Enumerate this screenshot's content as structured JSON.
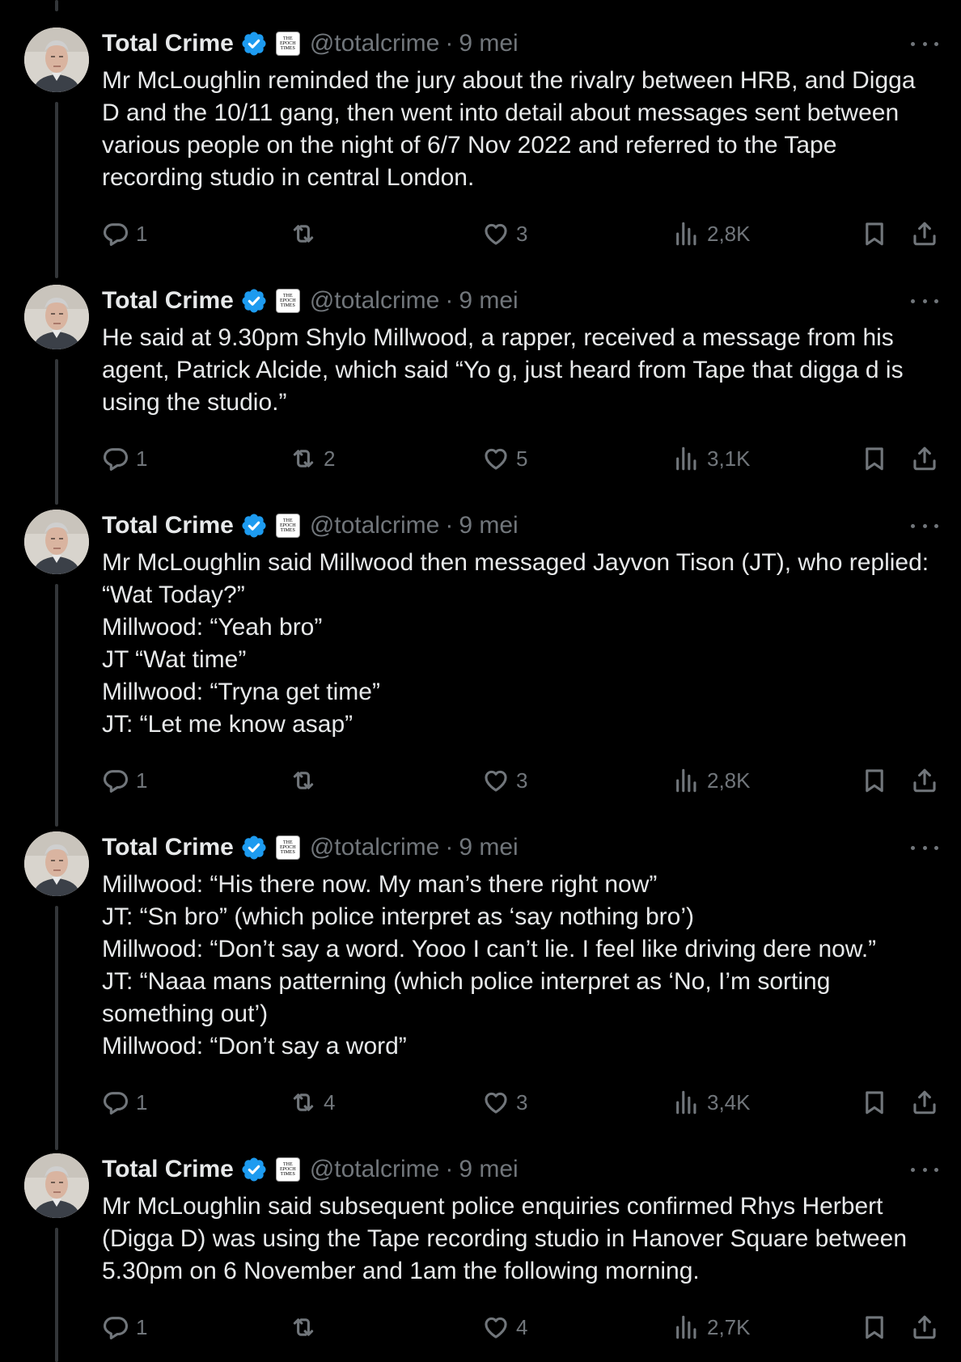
{
  "tweets": [
    {
      "name": "Total Crime",
      "handle": "@totalcrime",
      "separator": "·",
      "date": "9 mei",
      "text": "Mr McLoughlin reminded the jury about the rivalry between HRB, and Digga D and the 10/11 gang, then went into detail about messages sent between various people on the night of 6/7 Nov 2022 and referred to the Tape recording studio in central London.",
      "replies": "1",
      "retweets": "",
      "likes": "3",
      "views": "2,8K"
    },
    {
      "name": "Total Crime",
      "handle": "@totalcrime",
      "separator": "·",
      "date": "9 mei",
      "text": "He said at 9.30pm Shylo Millwood, a rapper, received a message from his agent, Patrick Alcide, which said “Yo g, just heard from Tape that digga d is using the studio.”",
      "replies": "1",
      "retweets": "2",
      "likes": "5",
      "views": "3,1K"
    },
    {
      "name": "Total Crime",
      "handle": "@totalcrime",
      "separator": "·",
      "date": "9 mei",
      "text": "Mr McLoughlin said Millwood then messaged Jayvon Tison (JT), who replied: “Wat Today?”\nMillwood: “Yeah bro”\nJT “Wat time”\nMillwood: “Tryna get time”\nJT: “Let me know asap”",
      "replies": "1",
      "retweets": "",
      "likes": "3",
      "views": "2,8K"
    },
    {
      "name": "Total Crime",
      "handle": "@totalcrime",
      "separator": "·",
      "date": "9 mei",
      "text": "Millwood: “His there now. My man’s there right now”\nJT: “Sn bro” (which police interpret as ‘say nothing bro’)\nMillwood: “Don’t say a word. Yooo I can’t lie. I feel like driving dere now.”\nJT: “Naaa mans patterning (which police interpret as ‘No, I’m sorting something out’)\nMillwood: “Don’t say a word”",
      "replies": "1",
      "retweets": "4",
      "likes": "3",
      "views": "3,4K"
    },
    {
      "name": "Total Crime",
      "handle": "@totalcrime",
      "separator": "·",
      "date": "9 mei",
      "text": "Mr McLoughlin said subsequent police enquiries confirmed Rhys Herbert (Digga D) was using the Tape recording studio in Hanover Square between 5.30pm on 6 November and 1am the following morning.",
      "replies": "1",
      "retweets": "",
      "likes": "4",
      "views": "2,7K"
    }
  ],
  "affiliation_badge": {
    "line1": "THE",
    "line2": "EPOCH",
    "line3": "TIMES"
  },
  "colors": {
    "background": "#000000",
    "text": "#e7e9ea",
    "muted": "#71767b",
    "verified": "#1d9bf0",
    "thread_line": "#333639"
  },
  "icons": [
    "verified-badge-icon",
    "epoch-times-badge-icon",
    "more-icon",
    "reply-icon",
    "retweet-icon",
    "like-icon",
    "views-icon",
    "bookmark-icon",
    "share-icon"
  ]
}
